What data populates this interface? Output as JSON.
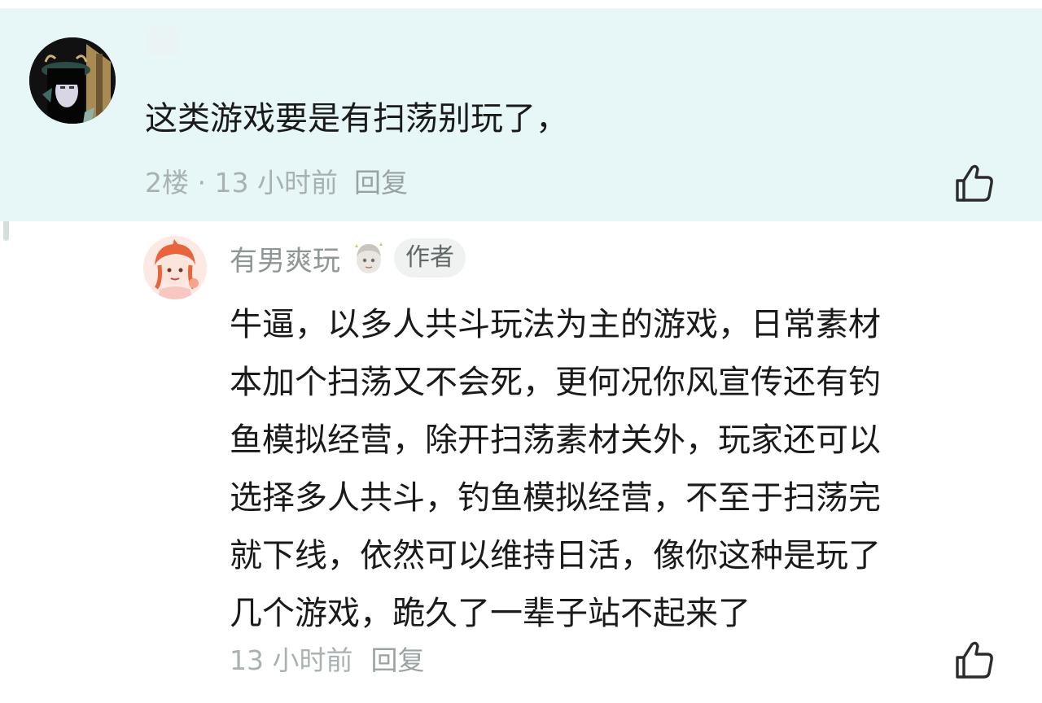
{
  "comments": [
    {
      "text": "这类游戏要是有扫荡别玩了，",
      "floor": "2楼",
      "separator": " · ",
      "time": "13 小时前",
      "reply_label": "回复",
      "like_icon": "thumbs-up-icon"
    }
  ],
  "reply": {
    "username": "有男爽玩",
    "author_badge": "作者",
    "lines": [
      "牛逼，以多人共斗玩法为主的游戏，日常素材",
      "本加个扫荡又不会死，更何况你风宣传还有钓",
      "鱼模拟经营，除开扫荡素材关外，玩家还可以",
      "选择多人共斗，钓鱼模拟经营，不至于扫荡完",
      "就下线，依然可以维持日活，像你这种是玩了",
      "几个游戏，跪久了一辈子站不起来了"
    ],
    "time": "13 小时前",
    "reply_label": "回复",
    "like_icon": "thumbs-up-icon"
  },
  "colors": {
    "highlight_bg": "#e7f6f7",
    "text": "#1a1a1a",
    "meta": "#a9b1b1",
    "badge_bg": "#f0f2f2"
  }
}
